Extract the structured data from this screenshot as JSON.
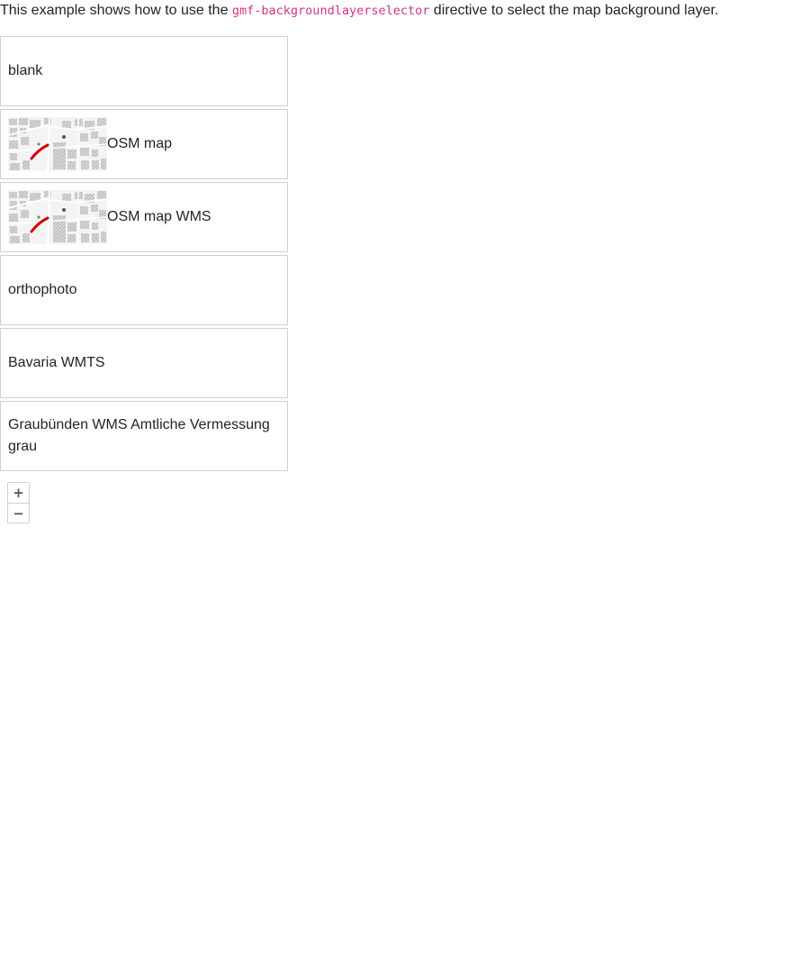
{
  "intro": {
    "before": "This example shows how to use the ",
    "code": "gmf-backgroundlayerselector",
    "after": " directive to select the map background layer."
  },
  "layers": [
    {
      "label": "blank",
      "has_thumbnail": false
    },
    {
      "label": "OSM map",
      "has_thumbnail": true
    },
    {
      "label": "OSM map WMS",
      "has_thumbnail": true
    },
    {
      "label": "orthophoto",
      "has_thumbnail": false
    },
    {
      "label": "Bavaria WMTS",
      "has_thumbnail": false
    },
    {
      "label": "Graubünden WMS Amtliche Vermessung grau",
      "has_thumbnail": false
    }
  ],
  "zoom": {
    "in_label": "+",
    "out_label": "−"
  },
  "colors": {
    "code": "#d63384",
    "route": "#d40000",
    "border": "#d0d0d0"
  },
  "icons": {
    "thumbnail": "osm-map-thumbnail"
  }
}
